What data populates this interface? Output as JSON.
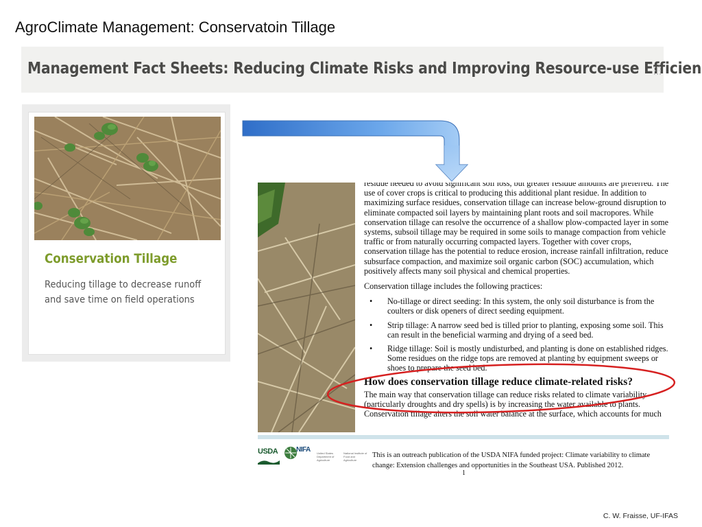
{
  "slide": {
    "title": "AgroClimate Management: Conservatoin Tillage",
    "credit": "C. W. Fraisse, UF-IFAS"
  },
  "banner": {
    "title": "Management Fact Sheets: Reducing Climate Risks and Improving Resource-use Efficiency"
  },
  "card": {
    "title": "Conservation Tillage",
    "description": "Reducing tillage to decrease runoff and save time on field operations"
  },
  "document": {
    "paragraph1": "residue needed to avoid significant soil loss, but greater residue amounts are preferred. The use of cover crops is critical to producing this additional plant residue. In addition to maximizing surface residues, conservation tillage can increase below-ground disruption to eliminate compacted soil layers by maintaining plant roots and soil macropores. While conservation tillage can resolve the occurrence of a shallow plow-compacted layer in some systems, subsoil tillage may be required in some soils to manage compaction from vehicle traffic or from naturally occurring compacted layers. Together with cover crops, conservation tillage has the potential to reduce erosion, increase rainfall infiltration, reduce subsurface compaction, and maximize soil organic carbon (SOC) accumulation, which positively affects many soil physical and chemical properties.",
    "paragraph2": "Conservation tillage includes the following practices:",
    "practices": [
      "No-tillage or direct seeding: In this system, the only soil disturbance is from the coulters or disk openers of direct seeding equipment.",
      "Strip tillage: A narrow seed bed is tilled prior to planting, exposing some soil. This can result in the beneficial warming and drying of a seed bed.",
      "Ridge tillage: Soil is mostly undisturbed, and planting is done on established ridges. Some residues on the ridge tops are removed at planting by equipment sweeps or shoes to prepare the seed bed."
    ],
    "heading": "How does conservation tillage reduce climate-related risks?",
    "paragraph3": "The main way that conservation tillage can reduce risks related to climate variability (particularly droughts and dry spells) is by increasing the water available to plants. Conservation tillage alters the soil water balance at the surface, which accounts for much",
    "footer": {
      "usda": "USDA",
      "nifa": "NIFA",
      "usda_agency": "United States Department of Agriculture",
      "nifa_agency": "National Institute of Food and Agriculture",
      "publication": "This is an outreach publication of the USDA NIFA funded project: Climate variability to climate change: Extension challenges and opportunities in the Southeast USA. Published 2012.",
      "page": "1"
    }
  },
  "colors": {
    "card_title": "#7e9c2c",
    "arrow": "#3f7fd4",
    "highlight_ellipse": "#d62020"
  }
}
